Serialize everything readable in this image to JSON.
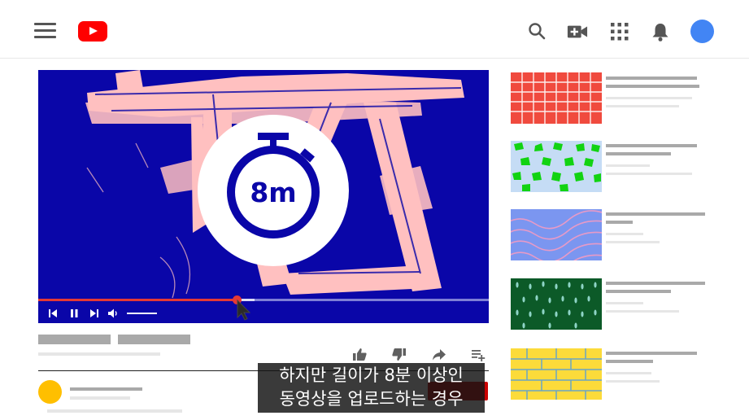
{
  "header": {
    "menu_icon": "hamburger-menu-icon",
    "logo_icon": "youtube-logo-icon",
    "right_icons": [
      "search-icon",
      "video-camera-add-icon",
      "apps-grid-icon",
      "notification-bell-icon"
    ],
    "avatar_color": "#4285f4",
    "brand_color": "#ff0000"
  },
  "player": {
    "background_color": "#0a06a8",
    "brush_color": "#ffc0c0",
    "timer_label": "8m",
    "timer_color": "#0a06a8",
    "progress": 0.44,
    "buffered": 0.48,
    "controls": [
      "skip-previous-icon",
      "pause-icon",
      "skip-next-icon",
      "volume-icon"
    ]
  },
  "video_actions": [
    "thumbs-up-icon",
    "thumbs-down-icon",
    "share-icon",
    "add-to-playlist-icon"
  ],
  "comment": {
    "avatar_color": "#ffbf00",
    "button_color": "#cc0000"
  },
  "caption": {
    "line1": "하지만 길이가 8분 이상인",
    "line2": "동영상을 업로드하는 경우"
  },
  "sidebar": {
    "thumbnails": [
      {
        "pattern": "brick-grid",
        "colors": [
          "#f04a3e",
          "#ffffff"
        ]
      },
      {
        "pattern": "green-blobs",
        "colors": [
          "#c5dcf5",
          "#12d312"
        ]
      },
      {
        "pattern": "waves",
        "colors": [
          "#7b96f0",
          "#e79ac7"
        ]
      },
      {
        "pattern": "drops",
        "colors": [
          "#0c5a28",
          "#8ed4c6"
        ]
      },
      {
        "pattern": "yellow-bricks",
        "colors": [
          "#fcdb3a",
          "#6aa5c5"
        ]
      }
    ]
  }
}
